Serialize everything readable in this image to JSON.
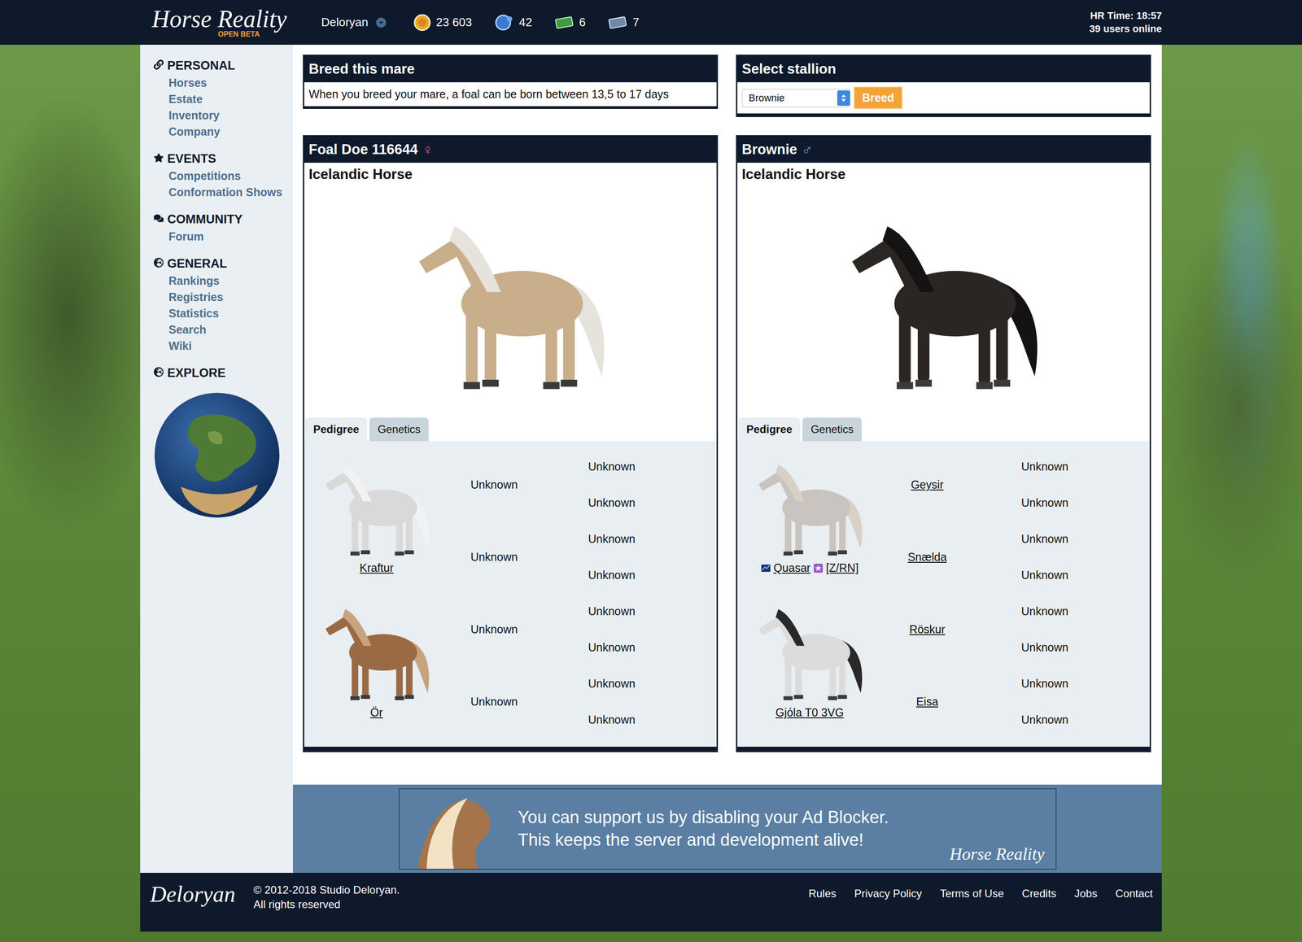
{
  "header": {
    "logo": "Horse Reality",
    "logo_sub": "OPEN BETA",
    "user": "Deloryan",
    "currencies": [
      {
        "value": "23 603",
        "kind": "coin"
      },
      {
        "value": "42",
        "kind": "diamond"
      },
      {
        "value": "6",
        "kind": "ticket"
      },
      {
        "value": "7",
        "kind": "voucher"
      }
    ],
    "time": "HR Time: 18:57",
    "online": "39 users online"
  },
  "sidebar": [
    {
      "heading": "PERSONAL",
      "icon": "link",
      "items": [
        "Horses",
        "Estate",
        "Inventory",
        "Company"
      ]
    },
    {
      "heading": "EVENTS",
      "icon": "star",
      "items": [
        "Competitions",
        "Conformation Shows"
      ]
    },
    {
      "heading": "COMMUNITY",
      "icon": "comments",
      "items": [
        "Forum"
      ]
    },
    {
      "heading": "GENERAL",
      "icon": "globe",
      "items": [
        "Rankings",
        "Registries",
        "Statistics",
        "Search",
        "Wiki"
      ]
    },
    {
      "heading": "EXPLORE",
      "icon": "globe",
      "items": []
    }
  ],
  "breed": {
    "title": "Breed this mare",
    "text": "When you breed your mare, a foal can be born between 13,5 to 17 days"
  },
  "select": {
    "title": "Select stallion",
    "value": "Brownie",
    "button": "Breed"
  },
  "horses": [
    {
      "name": "Foal Doe 116644",
      "sex": "♀",
      "sex_color": "#e0508a",
      "breed": "Icelandic Horse",
      "color": "#c9ae8c",
      "mane": "#e6e2dc",
      "tabs": [
        {
          "label": "Pedigree",
          "selected": true
        },
        {
          "label": "Genetics",
          "selected": false
        }
      ],
      "parents": [
        {
          "name": "Kraftur",
          "title": "",
          "special": false,
          "color": "#d9d9d9",
          "mane": "#f2f2f2"
        },
        {
          "name": "Ör",
          "title": "",
          "special": false,
          "color": "#9a6a45",
          "mane": "#c9a27e"
        }
      ],
      "grandparents": [
        "Unknown",
        "Unknown",
        "Unknown",
        "Unknown"
      ],
      "great": [
        "Unknown",
        "Unknown",
        "Unknown",
        "Unknown",
        "Unknown",
        "Unknown",
        "Unknown",
        "Unknown"
      ]
    },
    {
      "name": "Brownie",
      "sex": "♂",
      "sex_color": "#6ea2d6",
      "breed": "Icelandic Horse",
      "color": "#2a2624",
      "mane": "#141212",
      "tabs": [
        {
          "label": "Pedigree",
          "selected": true
        },
        {
          "label": "Genetics",
          "selected": false
        }
      ],
      "parents": [
        {
          "name": "Quasar",
          "title": "[Z/RN]",
          "special": true,
          "color": "#c9c4c0",
          "mane": "#d8d2c6"
        },
        {
          "name": "Gjóla T0 3VG",
          "title": "",
          "special": false,
          "color": "#dcdcdc",
          "mane": "#2a2828"
        }
      ],
      "grandparents": [
        "Geysir",
        "Snælda",
        "Röskur",
        "Eisa"
      ],
      "great": [
        "Unknown",
        "Unknown",
        "Unknown",
        "Unknown",
        "Unknown",
        "Unknown",
        "Unknown",
        "Unknown"
      ]
    }
  ],
  "ad": {
    "line1": "You can support us by disabling your Ad Blocker.",
    "line2": "This keeps the server and development alive!",
    "brand": "Horse Reality"
  },
  "footer": {
    "logo": "Deloryan",
    "copyright": "© 2012-2018 Studio Deloryan.",
    "rights": "All rights reserved",
    "links": [
      "Rules",
      "Privacy Policy",
      "Terms of Use",
      "Credits",
      "Jobs",
      "Contact"
    ]
  }
}
